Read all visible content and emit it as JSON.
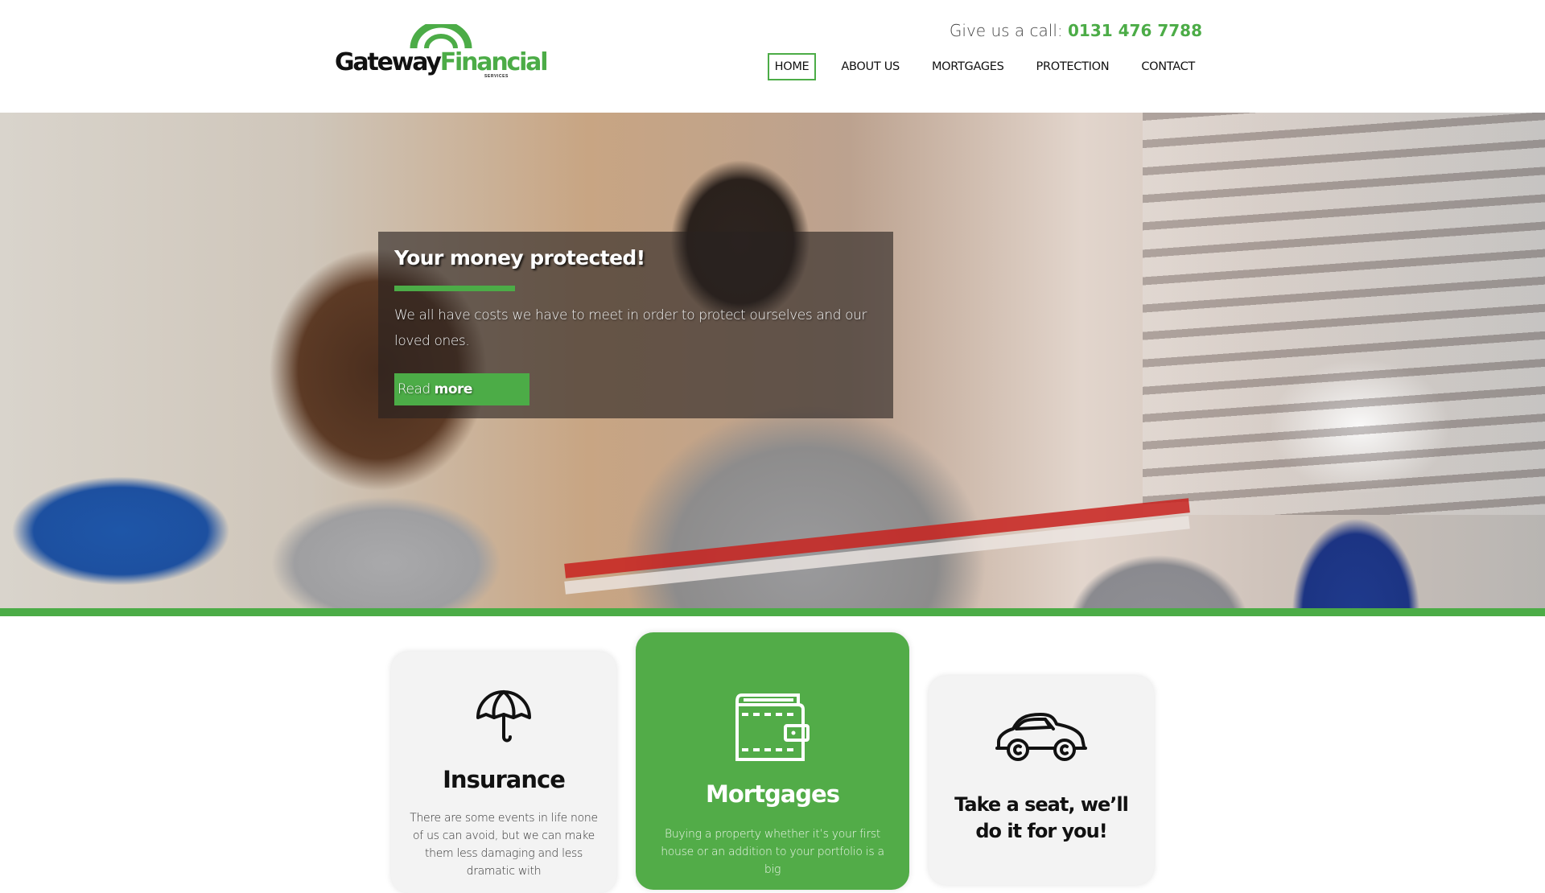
{
  "brand": {
    "logo_primary": "Gateway",
    "logo_secondary": "Financial",
    "logo_sub": "SERVICES",
    "accent_color": "#4cac47"
  },
  "header": {
    "call_label": "Give us a call:",
    "phone": "0131 476 7788"
  },
  "nav": {
    "items": [
      {
        "label": "HOME",
        "active": true
      },
      {
        "label": "ABOUT US",
        "active": false
      },
      {
        "label": "MORTGAGES",
        "active": false
      },
      {
        "label": "PROTECTION",
        "active": false
      },
      {
        "label": "CONTACT",
        "active": false
      }
    ]
  },
  "hero": {
    "title": "Your money protected!",
    "text": "We all have costs we have to meet in order to protect ourselves and our loved ones.",
    "button_light": "Read",
    "button_bold": "more"
  },
  "cards": [
    {
      "icon": "umbrella-icon",
      "title": "Insurance",
      "text": "There are some events in life none of us can avoid, but we can make them less damaging and less dramatic with"
    },
    {
      "icon": "wallet-icon",
      "title": "Mortgages",
      "text": "Buying a property whether it’s your first house or an addition to your portfolio is a big"
    },
    {
      "icon": "car-icon",
      "title": "Take a seat, we’ll do it for you!",
      "text": ""
    }
  ]
}
